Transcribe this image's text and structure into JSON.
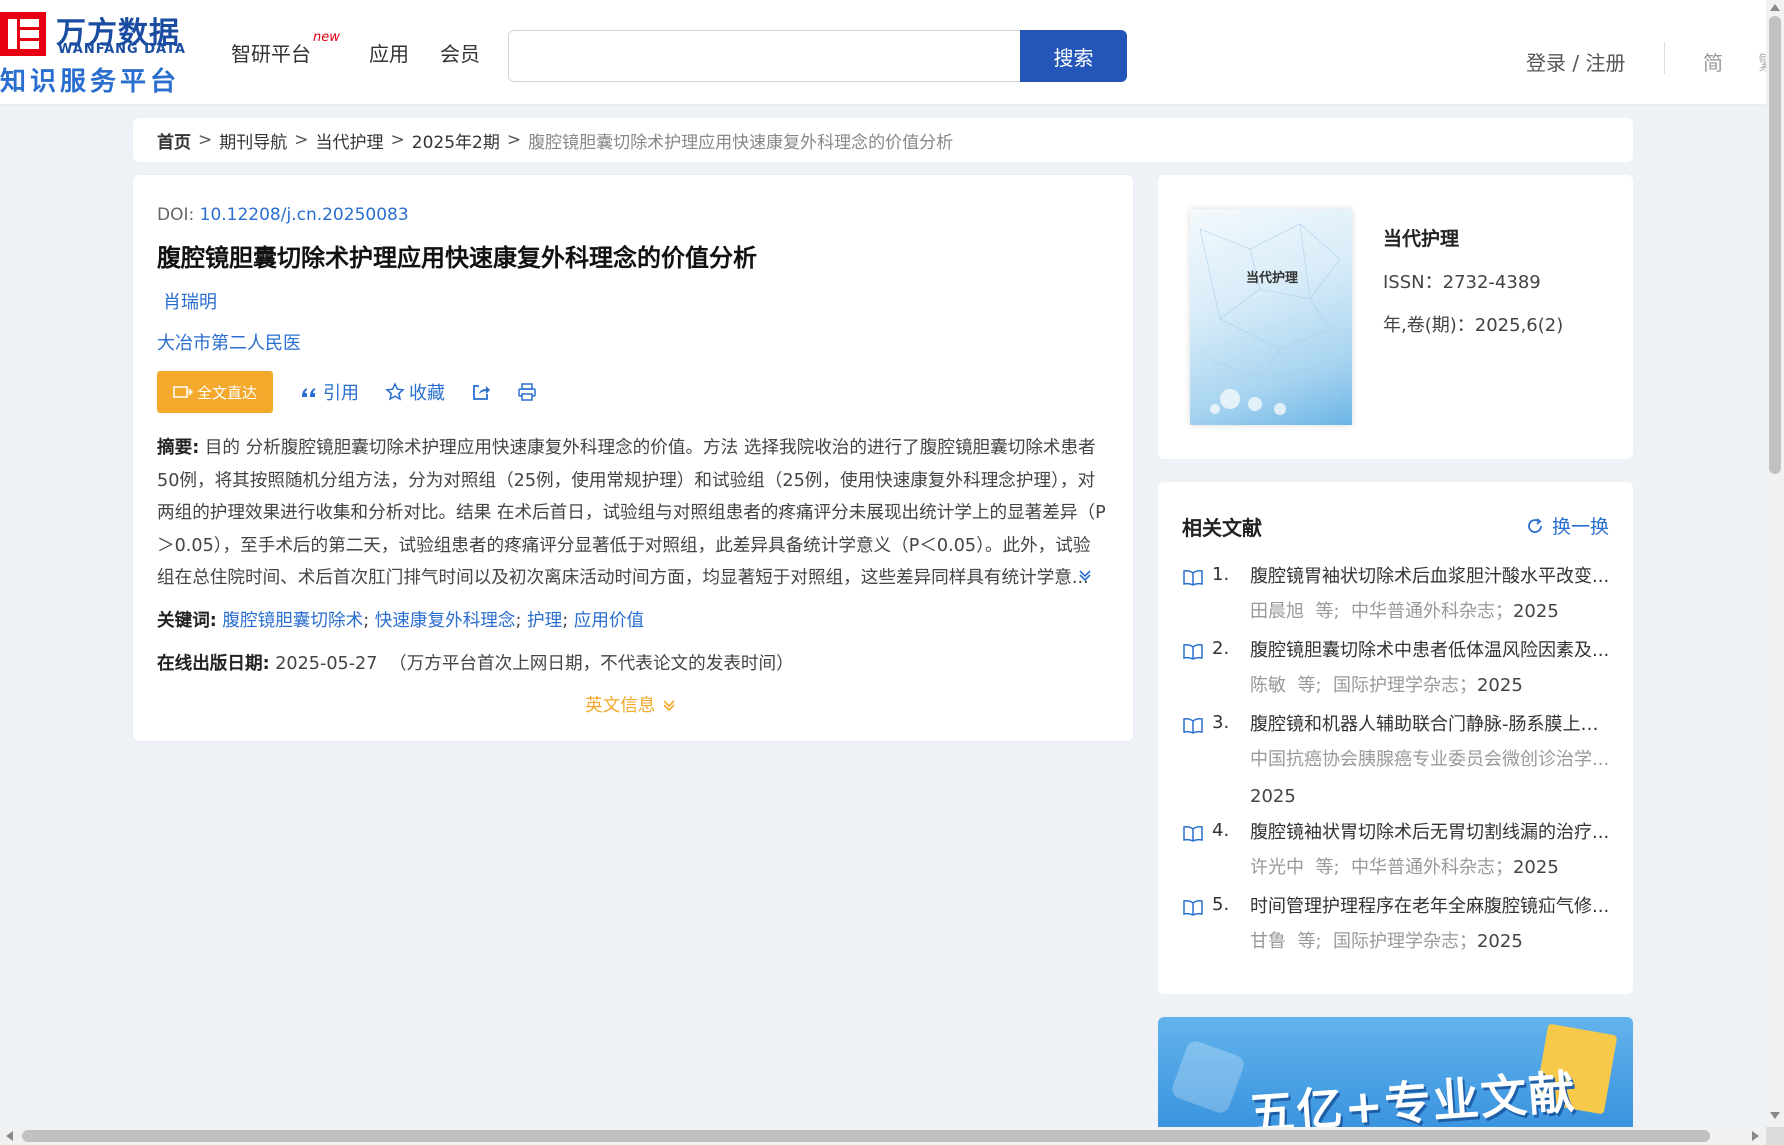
{
  "header": {
    "logo_cn": "万方数据",
    "logo_en": "WANFANG DATA",
    "logo_sub": "知识服务平台",
    "nav": [
      {
        "label": "智研平台",
        "badge": "new"
      },
      {
        "label": "应用"
      },
      {
        "label": "会员"
      }
    ],
    "search": {
      "placeholder": "",
      "value": "",
      "button": "搜索"
    },
    "login": "登录 / 注册",
    "lang": [
      "简",
      "繁"
    ]
  },
  "breadcrumb": [
    "首页",
    "期刊导航",
    "当代护理",
    "2025年2期",
    "腹腔镜胆囊切除术护理应用快速康复外科理念的价值分析"
  ],
  "article": {
    "doi_label": "DOI:",
    "doi": "10.12208/j.cn.20250083",
    "title": "腹腔镜胆囊切除术护理应用快速康复外科理念的价值分析",
    "author": "肖瑞明",
    "org": "大冶市第二人民医",
    "actions": {
      "fulltext": "全文直达",
      "cite": "引用",
      "favorite": "收藏"
    },
    "abstract_label": "摘要:",
    "abstract": "目的 分析腹腔镜胆囊切除术护理应用快速康复外科理念的价值。方法 选择我院收治的进行了腹腔镜胆囊切除术患者50例，将其按照随机分组方法，分为对照组（25例，使用常规护理）和试验组（25例，使用快速康复外科理念护理），对两组的护理效果进行收集和分析对比。结果 在术后首日，试验组与对照组患者的疼痛评分未展现出统计学上的显著差异（P＞0.05），至手术后的第二天，试验组患者的疼痛评分显著低于对照组，此差异具备统计学意义（P＜0.05）。此外，试验组在总住院时间、术后首次肛门排气时间以及初次离床活动时间方面，均显著短于对照组，这些差异同样具有统计学意...",
    "keywords_label": "关键词:",
    "keywords": [
      "腹腔镜胆囊切除术",
      "快速康复外科理念",
      "护理",
      "应用价值"
    ],
    "pubdate_label": "在线出版日期:",
    "pubdate": "2025-05-27",
    "pubdate_note": "（万方平台首次上网日期，不代表论文的发表时间）",
    "english_info": "英文信息"
  },
  "journal": {
    "cover_title": "当代护理",
    "name": "当代护理",
    "issn": "ISSN：2732-4389",
    "year": "年,卷(期)：2025,6(2)"
  },
  "related": {
    "heading": "相关文献",
    "refresh": "换一换",
    "items": [
      {
        "num": "1.",
        "title": "腹腔镜胃袖状切除术后血浆胆汁酸水平改变...",
        "authors": "田晨旭",
        "journal": "中华普通外科杂志",
        "year": "2025"
      },
      {
        "num": "2.",
        "title": "腹腔镜胆囊切除术中患者低体温风险因素及...",
        "authors": "陈敏",
        "journal": "国际护理学杂志",
        "year": "2025"
      },
      {
        "num": "3.",
        "title": "腹腔镜和机器人辅助联合门静脉-肠系膜上静...",
        "authors": "中国抗癌协会胰腺癌专业委员会微创诊治学...",
        "journal": "",
        "year": "2025"
      },
      {
        "num": "4.",
        "title": "腹腔镜袖状胃切除术后无胃切割线漏的治疗...",
        "authors": "许光中",
        "journal": "中华普通外科杂志",
        "year": "2025"
      },
      {
        "num": "5.",
        "title": "时间管理护理程序在老年全麻腹腔镜疝气修...",
        "authors": "甘鲁",
        "journal": "国际护理学杂志",
        "year": "2025"
      }
    ],
    "etal": "等;"
  },
  "banner": {
    "text": "五亿+专业文献"
  }
}
